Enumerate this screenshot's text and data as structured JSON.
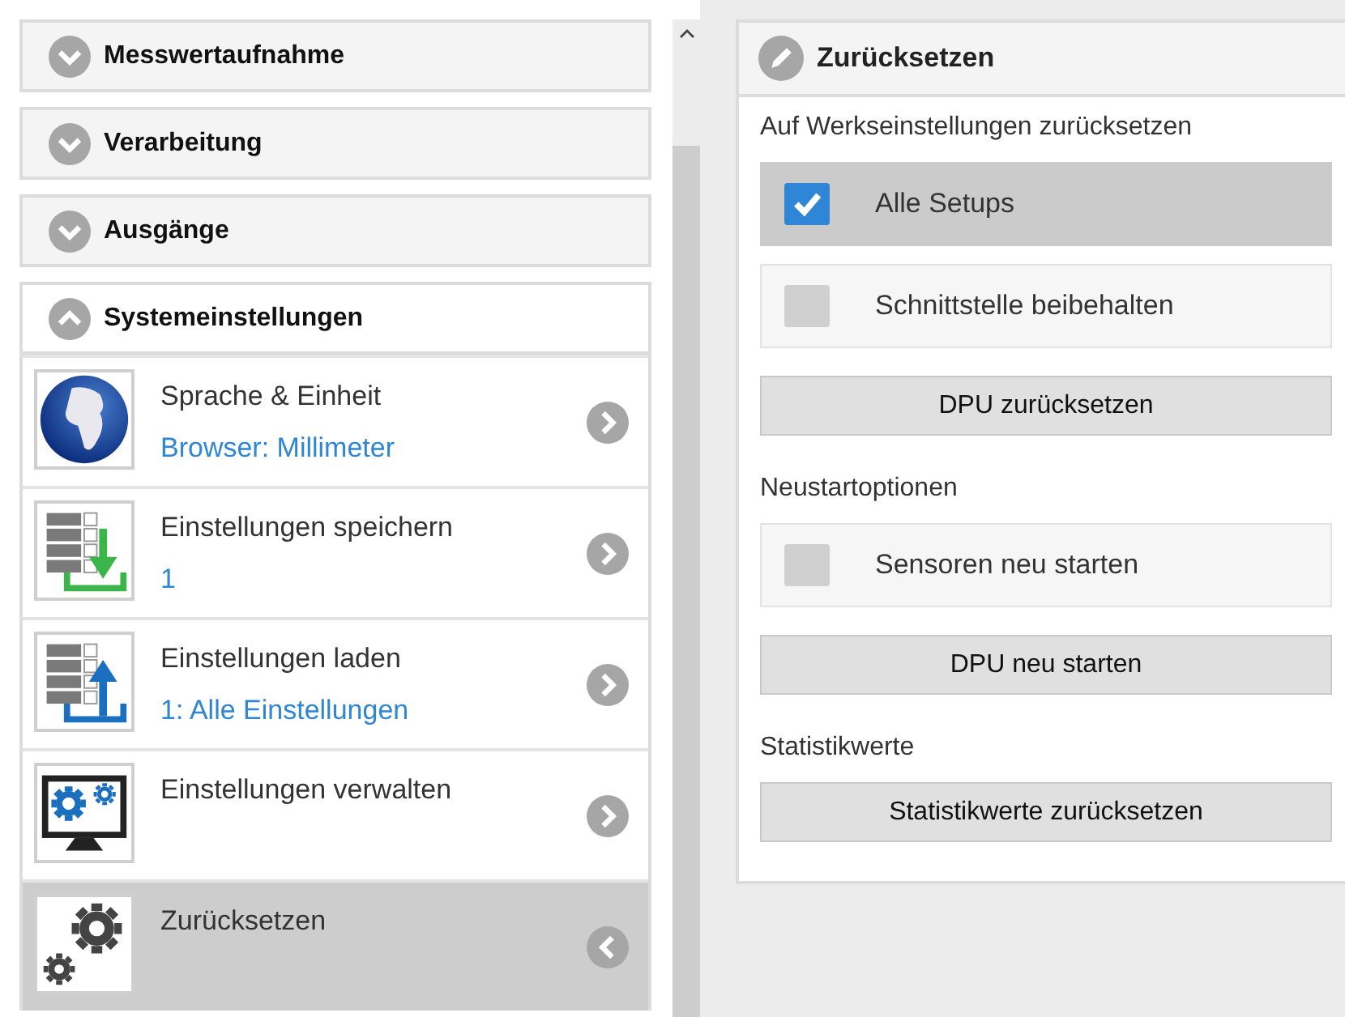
{
  "sidebar": {
    "sections": [
      {
        "label": "Messwertaufnahme",
        "expanded": false
      },
      {
        "label": "Verarbeitung",
        "expanded": false
      },
      {
        "label": "Ausgänge",
        "expanded": false
      },
      {
        "label": "Systemeinstellungen",
        "expanded": true,
        "items": [
          {
            "kind": "globe",
            "title": "Sprache & Einheit",
            "value": "Browser: Millimeter",
            "selected": false
          },
          {
            "kind": "save",
            "title": "Einstellungen speichern",
            "value": "1",
            "selected": false
          },
          {
            "kind": "load",
            "title": "Einstellungen laden",
            "value": "1: Alle Einstellungen",
            "selected": false
          },
          {
            "kind": "manage",
            "title": "Einstellungen verwalten",
            "selected": false
          },
          {
            "kind": "reset",
            "title": "Zurücksetzen",
            "selected": true
          }
        ]
      }
    ]
  },
  "panel": {
    "title": "Zurücksetzen",
    "groups": [
      {
        "label": "Auf Werkseinstellungen zurücksetzen",
        "options": [
          {
            "label": "Alle Setups",
            "checked": true
          },
          {
            "label": "Schnittstelle beibehalten",
            "checked": false
          }
        ],
        "button": "DPU zurücksetzen"
      },
      {
        "label": "Neustartoptionen",
        "options": [
          {
            "label": "Sensoren neu starten",
            "checked": false
          }
        ],
        "button": "DPU neu starten"
      },
      {
        "label": "Statistikwerte",
        "button": "Statistikwerte zurücksetzen"
      }
    ]
  }
}
